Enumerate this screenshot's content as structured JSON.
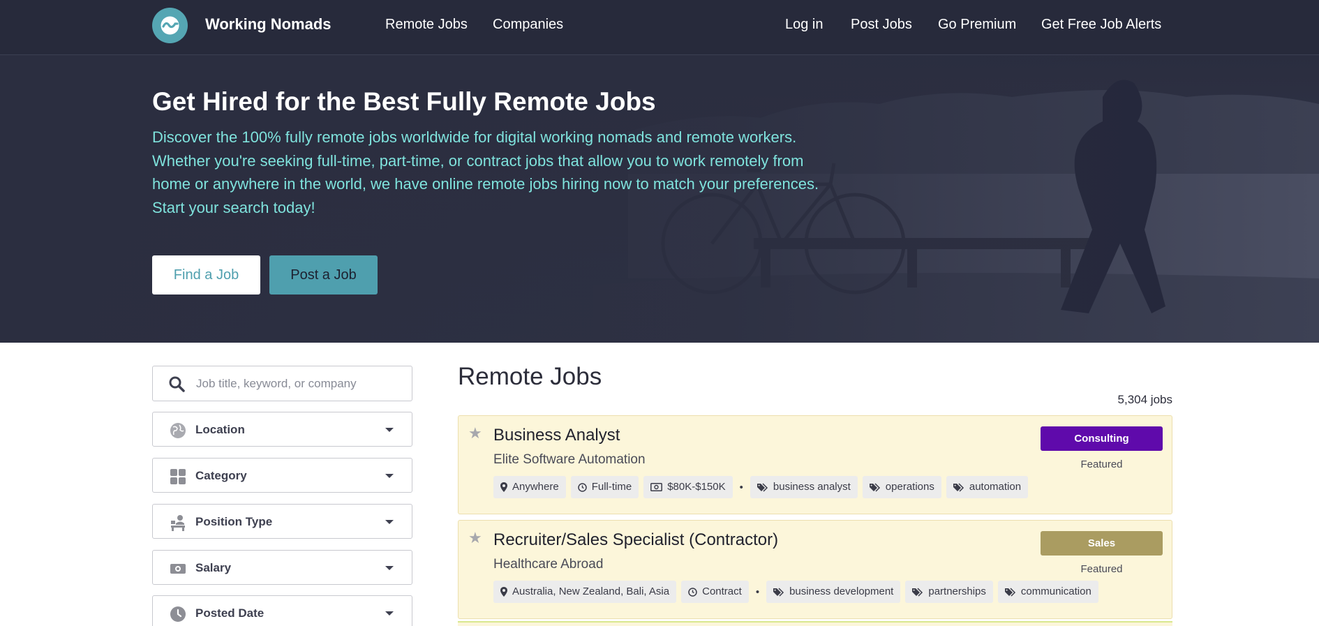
{
  "header": {
    "brand": "Working Nomads",
    "nav_left": [
      "Remote Jobs",
      "Companies"
    ],
    "nav_right": [
      "Log in",
      "Post Jobs",
      "Go Premium",
      "Get Free Job Alerts"
    ]
  },
  "hero": {
    "title": "Get Hired for the Best Fully Remote Jobs",
    "description": "Discover the 100% fully remote jobs worldwide for digital working nomads and remote workers. Whether you're seeking full-time, part-time, or contract jobs that allow you to work remotely from home or anywhere in the world, we have online remote jobs hiring now to match your preferences. Start your search today!",
    "find_button": "Find a Job",
    "post_button": "Post a Job"
  },
  "search": {
    "placeholder": "Job title, keyword, or company",
    "value": ""
  },
  "filters": [
    "Location",
    "Category",
    "Position Type",
    "Salary",
    "Posted Date"
  ],
  "main": {
    "title": "Remote Jobs",
    "count": "5,304 jobs"
  },
  "jobs": [
    {
      "title": "Business Analyst",
      "company": "Elite Software Automation",
      "category": "Consulting",
      "category_color": "#5f0aab",
      "featured": "Featured",
      "location": "Anywhere",
      "type": "Full-time",
      "salary": "$80K-$150K",
      "tags": [
        "business analyst",
        "operations",
        "automation"
      ]
    },
    {
      "title": "Recruiter/Sales Specialist (Contractor)",
      "company": "Healthcare Abroad",
      "category": "Sales",
      "category_color": "#aa9c61",
      "featured": "Featured",
      "location": "Australia, New Zealand, Bali, Asia",
      "type": "Contract",
      "tags": [
        "business development",
        "partnerships",
        "communication"
      ]
    }
  ],
  "colors": {
    "nav_bg": "#272a3b",
    "accent_teal": "#4f9fae",
    "hero_text": "#7fe3dd",
    "card_bg": "#fcf6da"
  }
}
